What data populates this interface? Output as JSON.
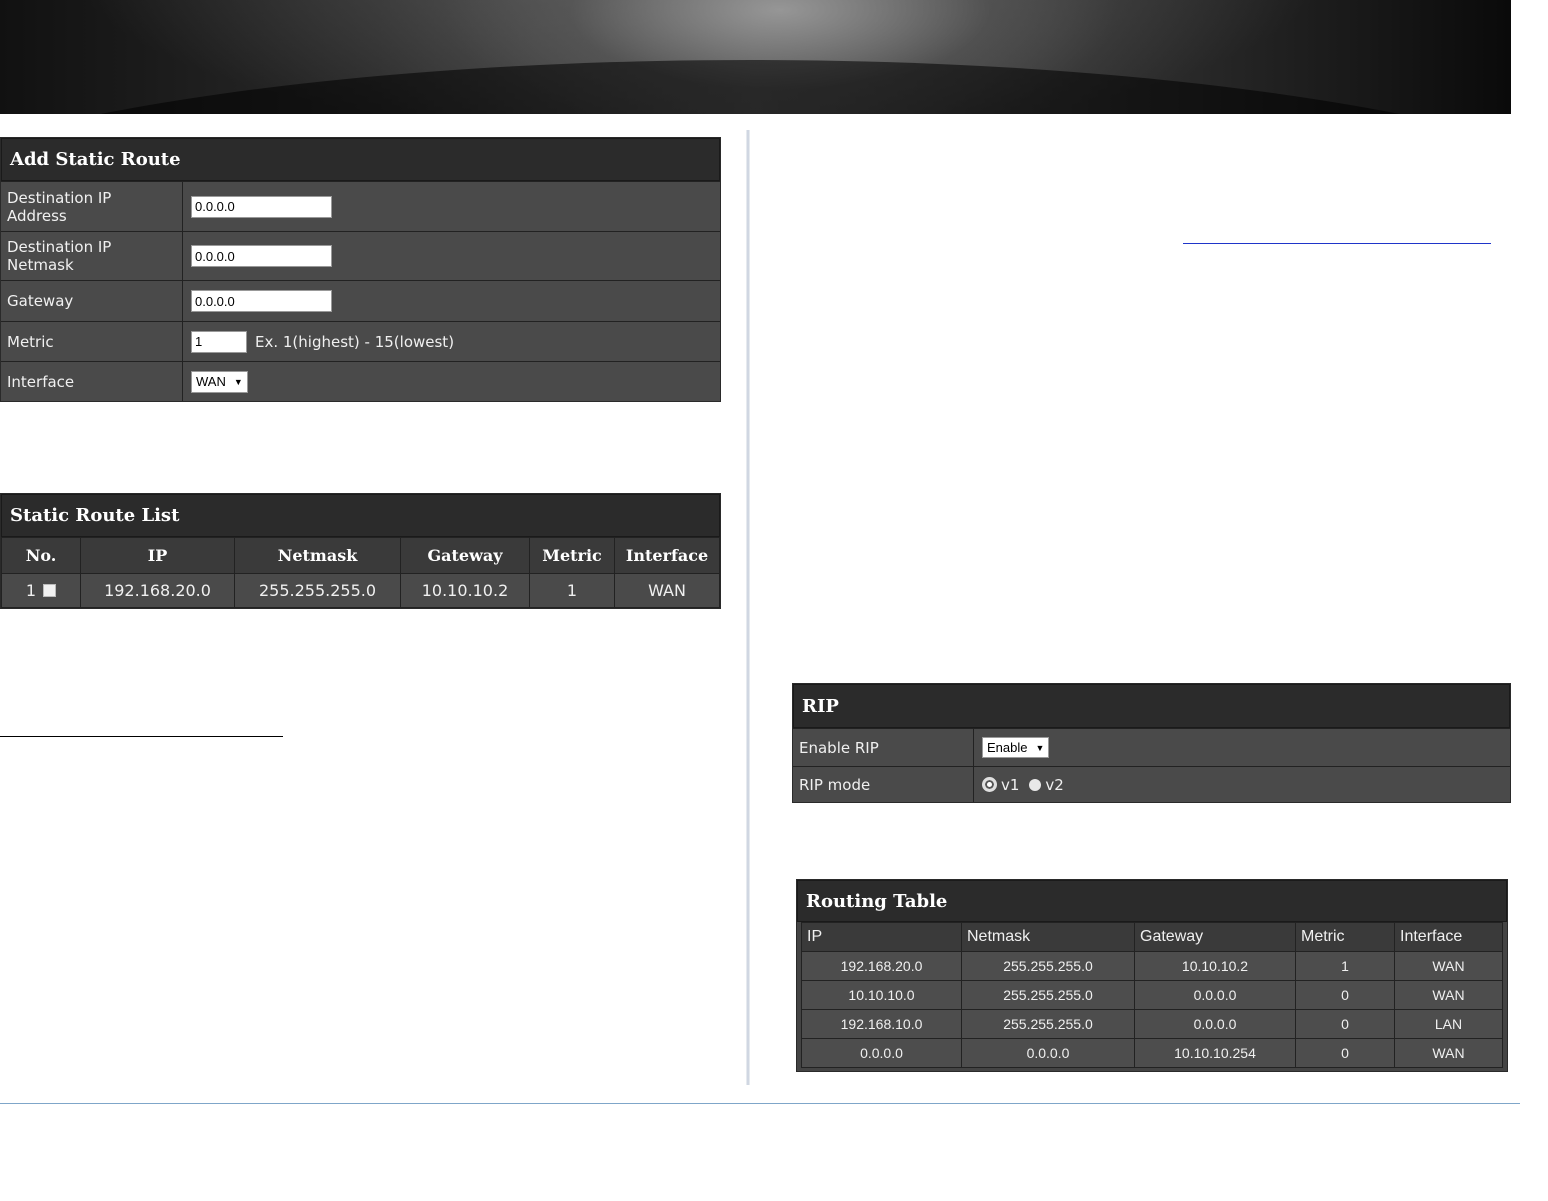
{
  "add_static_route": {
    "title": "Add Static Route",
    "rows": {
      "dest_ip_label": "Destination IP Address",
      "dest_ip_value": "0.0.0.0",
      "dest_mask_label": "Destination IP Netmask",
      "dest_mask_value": "0.0.0.0",
      "gateway_label": "Gateway",
      "gateway_value": "0.0.0.0",
      "metric_label": "Metric",
      "metric_value": "1",
      "metric_hint": "Ex. 1(highest) - 15(lowest)",
      "interface_label": "Interface",
      "interface_value": "WAN"
    }
  },
  "static_route_list": {
    "title": "Static Route List",
    "headers": [
      "No.",
      "IP",
      "Netmask",
      "Gateway",
      "Metric",
      "Interface"
    ],
    "rows": [
      {
        "no": "1",
        "ip": "192.168.20.0",
        "netmask": "255.255.255.0",
        "gateway": "10.10.10.2",
        "metric": "1",
        "interface": "WAN"
      }
    ]
  },
  "rip": {
    "title": "RIP",
    "enable_label": "Enable RIP",
    "enable_value": "Enable",
    "mode_label": "RIP mode",
    "mode_options": [
      "v1",
      "v2"
    ],
    "mode_selected": "v1"
  },
  "routing_table": {
    "title": "Routing Table",
    "headers": [
      "IP",
      "Netmask",
      "Gateway",
      "Metric",
      "Interface"
    ],
    "rows": [
      {
        "ip": "192.168.20.0",
        "netmask": "255.255.255.0",
        "gateway": "10.10.10.2",
        "metric": "1",
        "interface": "WAN"
      },
      {
        "ip": "10.10.10.0",
        "netmask": "255.255.255.0",
        "gateway": "0.0.0.0",
        "metric": "0",
        "interface": "WAN"
      },
      {
        "ip": "192.168.10.0",
        "netmask": "255.255.255.0",
        "gateway": "0.0.0.0",
        "metric": "0",
        "interface": "LAN"
      },
      {
        "ip": "0.0.0.0",
        "netmask": "0.0.0.0",
        "gateway": "10.10.10.254",
        "metric": "0",
        "interface": "WAN"
      }
    ]
  },
  "colors": {
    "panel_bg": "#4a4a4a",
    "panel_title_bg": "#2b2b2b",
    "link_underline": "#1f35c9",
    "bottom_rule": "#7fa6c9"
  }
}
